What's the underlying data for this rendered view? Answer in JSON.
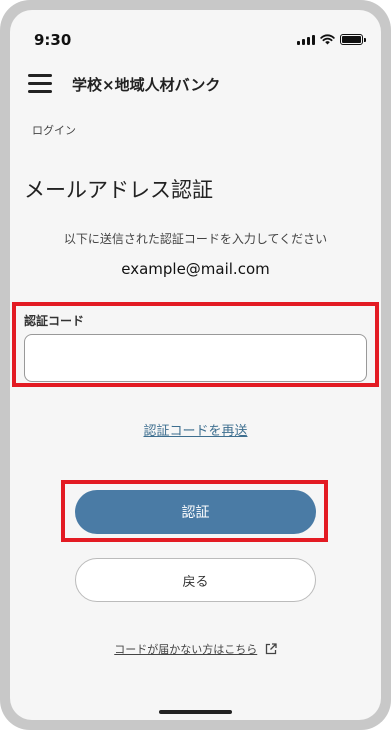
{
  "status_bar": {
    "time": "9:30"
  },
  "header": {
    "title": "学校×地域人材バンク",
    "menu_icon": "hamburger-icon"
  },
  "breadcrumb": "ログイン",
  "page": {
    "title": "メールアドレス認証",
    "instruction": "以下に送信された認証コードを入力してください",
    "email": "example@mail.com"
  },
  "form": {
    "code_label": "認証コード",
    "code_value": "",
    "code_placeholder": ""
  },
  "links": {
    "resend": "認証コードを再送",
    "help": "コードが届かない方はこちら"
  },
  "buttons": {
    "submit": "認証",
    "back": "戻る"
  },
  "colors": {
    "primary": "#4a7ba5",
    "highlight": "#e31b23",
    "link": "#3d6e8f"
  }
}
